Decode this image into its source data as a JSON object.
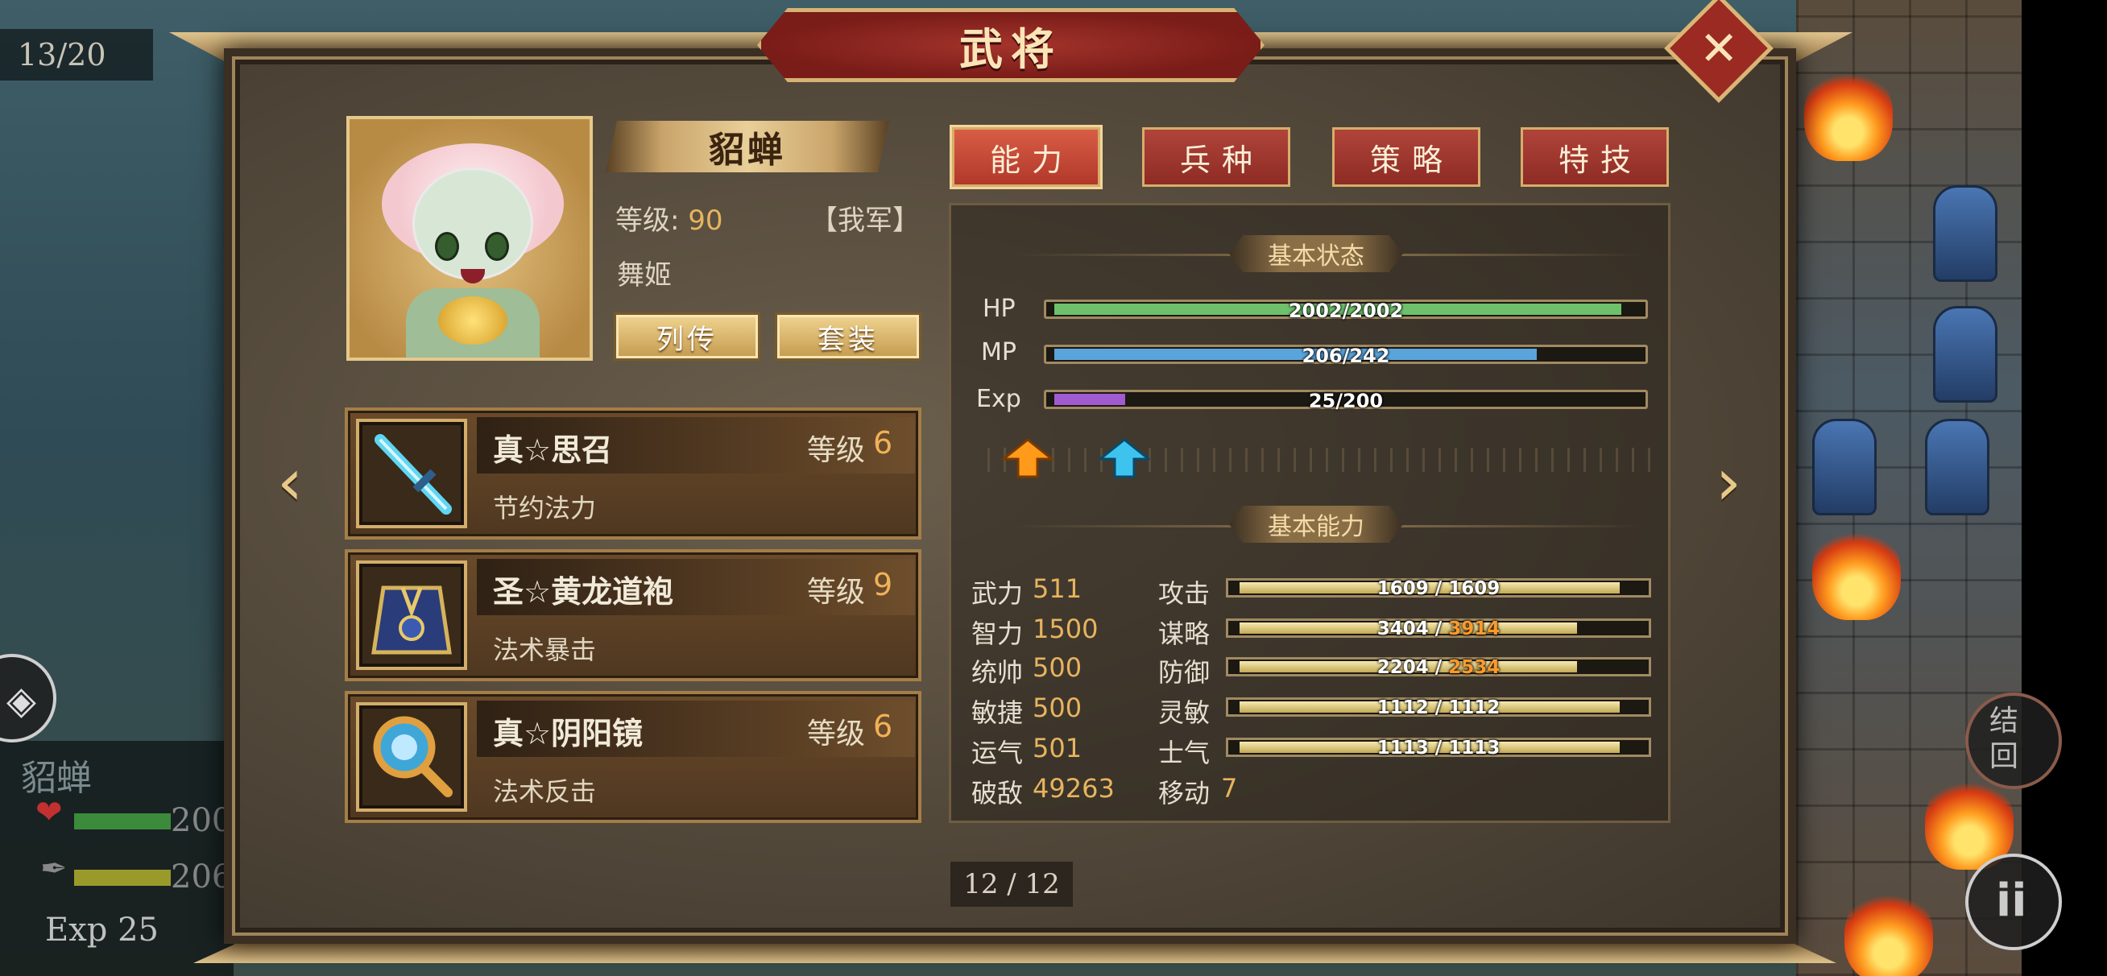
{
  "background": {
    "turn_counter": "13/20",
    "unit_name": "貂蝉",
    "unit_hp": "200",
    "unit_mp": "206",
    "unit_exp_label": "Exp",
    "unit_exp_value": "25",
    "right_button_text": "结\n回"
  },
  "dialog": {
    "title": "武将",
    "close_symbol": "✕",
    "prev_symbol": "‹",
    "next_symbol": "›"
  },
  "hero": {
    "name": "貂蝉",
    "level_label": "等级:",
    "level": "90",
    "faction": "【我军】",
    "class": "舞姬",
    "btn_biography": "列传",
    "btn_set": "套装"
  },
  "equipment": [
    {
      "name": "真☆思召",
      "level_label": "等级",
      "level": "6",
      "effect": "节约法力",
      "icon": "sword-icon"
    },
    {
      "name": "圣☆黄龙道袍",
      "level_label": "等级",
      "level": "9",
      "effect": "法术暴击",
      "icon": "robe-icon"
    },
    {
      "name": "真☆阴阳镜",
      "level_label": "等级",
      "level": "6",
      "effect": "法术反击",
      "icon": "mirror-icon"
    }
  ],
  "tabs": [
    {
      "label": "能力",
      "active": true
    },
    {
      "label": "兵种",
      "active": false
    },
    {
      "label": "策略",
      "active": false
    },
    {
      "label": "特技",
      "active": false
    }
  ],
  "status": {
    "title": "基本状态",
    "bars": [
      {
        "label": "HP",
        "text": "2002/2002",
        "current": 2002,
        "max": 2002,
        "color": "#6ec06b"
      },
      {
        "label": "MP",
        "text": "206/242",
        "current": 206,
        "max": 242,
        "color": "#5aa4dc"
      },
      {
        "label": "Exp",
        "text": "25/200",
        "current": 25,
        "max": 200,
        "color": "#a15bd1"
      }
    ]
  },
  "abilities": {
    "title": "基本能力",
    "stats": [
      {
        "name": "武力",
        "value": "511"
      },
      {
        "name": "智力",
        "value": "1500"
      },
      {
        "name": "统帅",
        "value": "500"
      },
      {
        "name": "敏捷",
        "value": "500"
      },
      {
        "name": "运气",
        "value": "501"
      },
      {
        "name": "破敌",
        "value": "49263"
      }
    ],
    "combat": [
      {
        "name": "攻击",
        "base": "1609",
        "sep": " / ",
        "total": "1609",
        "boosted": false,
        "fill": 0.98
      },
      {
        "name": "谋略",
        "base": "3404",
        "sep": " / ",
        "total": "3914",
        "boosted": true,
        "fill": 0.87
      },
      {
        "name": "防御",
        "base": "2204",
        "sep": " / ",
        "total": "2534",
        "boosted": true,
        "fill": 0.87
      },
      {
        "name": "灵敏",
        "base": "1112",
        "sep": " / ",
        "total": "1112",
        "boosted": false,
        "fill": 0.98
      },
      {
        "name": "士气",
        "base": "1113",
        "sep": " / ",
        "total": "1113",
        "boosted": false,
        "fill": 0.98
      }
    ],
    "move_label": "移动",
    "move_value": "7"
  },
  "page": "12 / 12"
}
